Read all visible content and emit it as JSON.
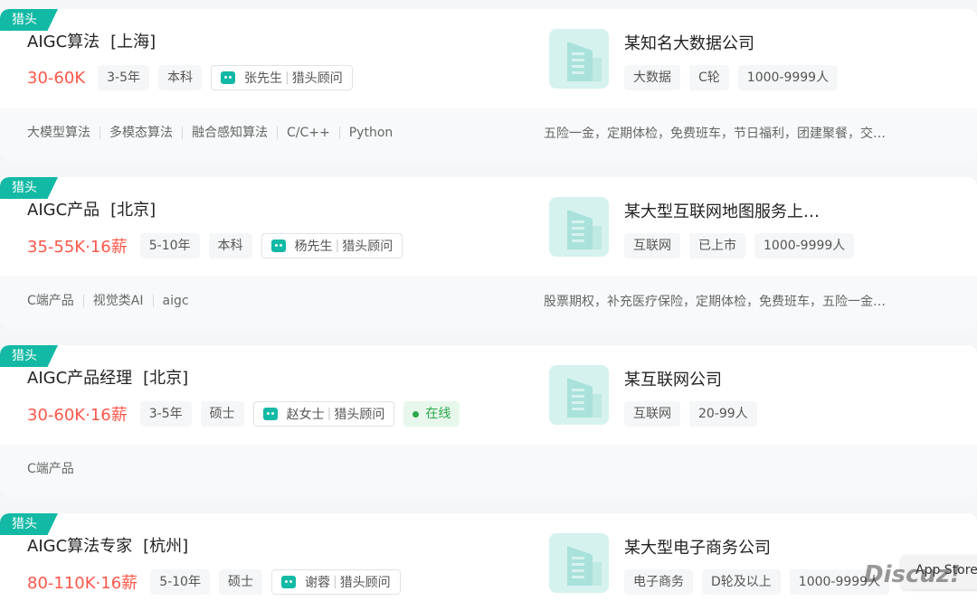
{
  "jobs": [
    {
      "badge": "猎头",
      "title": "AIGC算法",
      "city": "[上海]",
      "salary": "30-60K",
      "experience": "3-5年",
      "education": "本科",
      "recruiter_name": "张先生",
      "recruiter_role": "猎头顾问",
      "online": "",
      "company": "某知名大数据公司",
      "company_tags": [
        "大数据",
        "C轮",
        "1000-9999人"
      ],
      "skills": [
        "大模型算法",
        "多模态算法",
        "融合感知算法",
        "C/C++",
        "Python"
      ],
      "benefits": "五险一金，定期体检，免费班车，节日福利，团建聚餐，交…"
    },
    {
      "badge": "猎头",
      "title": "AIGC产品",
      "city": "[北京]",
      "salary": "35-55K·16薪",
      "experience": "5-10年",
      "education": "本科",
      "recruiter_name": "杨先生",
      "recruiter_role": "猎头顾问",
      "online": "",
      "company": "某大型互联网地图服务上…",
      "company_tags": [
        "互联网",
        "已上市",
        "1000-9999人"
      ],
      "skills": [
        "C端产品",
        "视觉类AI",
        "aigc"
      ],
      "benefits": "股票期权，补充医疗保险，定期体检，免费班车，五险一金…"
    },
    {
      "badge": "猎头",
      "title": "AIGC产品经理",
      "city": "[北京]",
      "salary": "30-60K·16薪",
      "experience": "3-5年",
      "education": "硕士",
      "recruiter_name": "赵女士",
      "recruiter_role": "猎头顾问",
      "online": "在线",
      "company": "某互联网公司",
      "company_tags": [
        "互联网",
        "20-99人"
      ],
      "skills": [
        "C端产品"
      ],
      "benefits": ""
    },
    {
      "badge": "猎头",
      "title": "AIGC算法专家",
      "city": "[杭州]",
      "salary": "80-110K·16薪",
      "experience": "5-10年",
      "education": "硕士",
      "recruiter_name": "谢蓉",
      "recruiter_role": "猎头顾问",
      "online": "",
      "company": "某大型电子商务公司",
      "company_tags": [
        "电子商务",
        "D轮及以上",
        "1000-9999人"
      ],
      "skills": [],
      "benefits": ""
    }
  ],
  "overlay": {
    "app_store": "App Store",
    "watermark": "Discuz!"
  },
  "colors": {
    "accent": "#12b9a4",
    "salary": "#fe574a",
    "online": "#2aa84b"
  }
}
